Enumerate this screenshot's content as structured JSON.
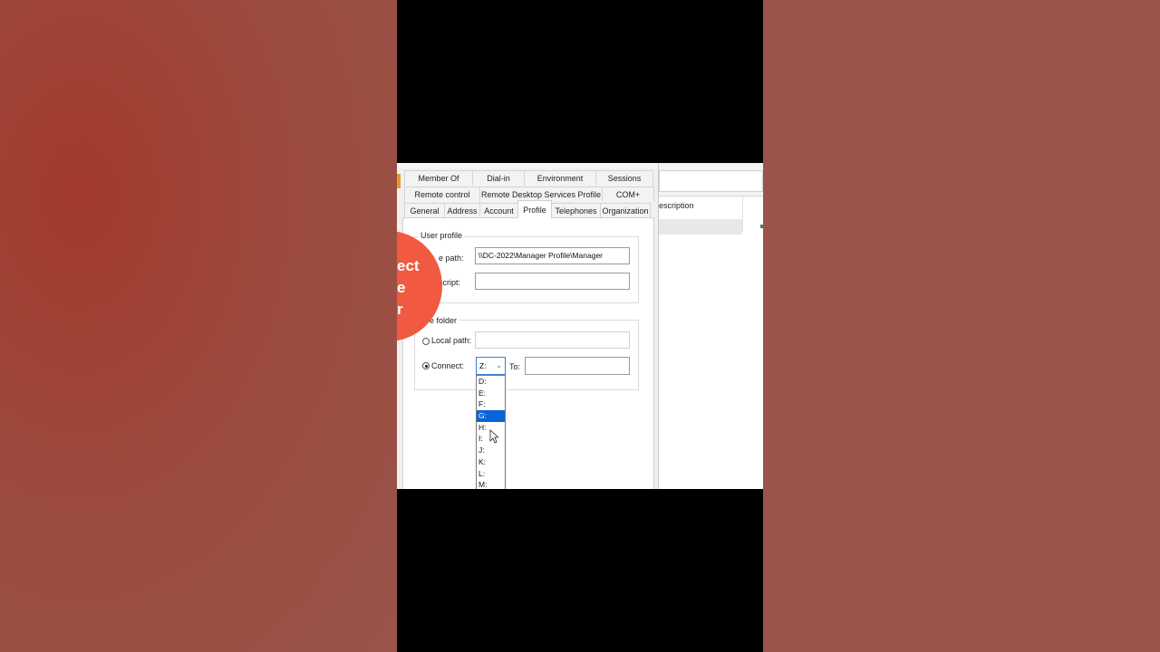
{
  "dialog": {
    "tabs_row1": [
      "Member Of",
      "Dial-in",
      "Environment",
      "Sessions"
    ],
    "tabs_row2": [
      "Remote control",
      "Remote Desktop Services Profile",
      "COM+"
    ],
    "tabs_row3": [
      "General",
      "Address",
      "Account",
      "Profile",
      "Telephones",
      "Organization"
    ],
    "active_tab": "Profile",
    "user_profile": {
      "group_label": "User profile",
      "profile_path_label": "e path:",
      "profile_path_value": "\\\\DC-2022\\Manager Profile\\Manager",
      "logon_script_label": "script:",
      "logon_script_value": ""
    },
    "home_folder": {
      "group_label": "e folder",
      "local_path_label": "Local path:",
      "local_path_value": "",
      "connect_label": "Connect:",
      "drive_value": "Z:",
      "to_label": "To:",
      "to_value": ""
    },
    "drive_options": [
      "D:",
      "E:",
      "F:",
      "G:",
      "H:",
      "I:",
      "J:",
      "K:",
      "L:",
      "M:"
    ],
    "selected_drive_option": "G:"
  },
  "right_window": {
    "column_header": "escription"
  },
  "overlay": {
    "lines": [
      "ect",
      "e",
      "r"
    ]
  },
  "colors": {
    "bubble": "#f15a40",
    "selection": "#0a64d6",
    "focus_border": "#3c7fd6"
  }
}
